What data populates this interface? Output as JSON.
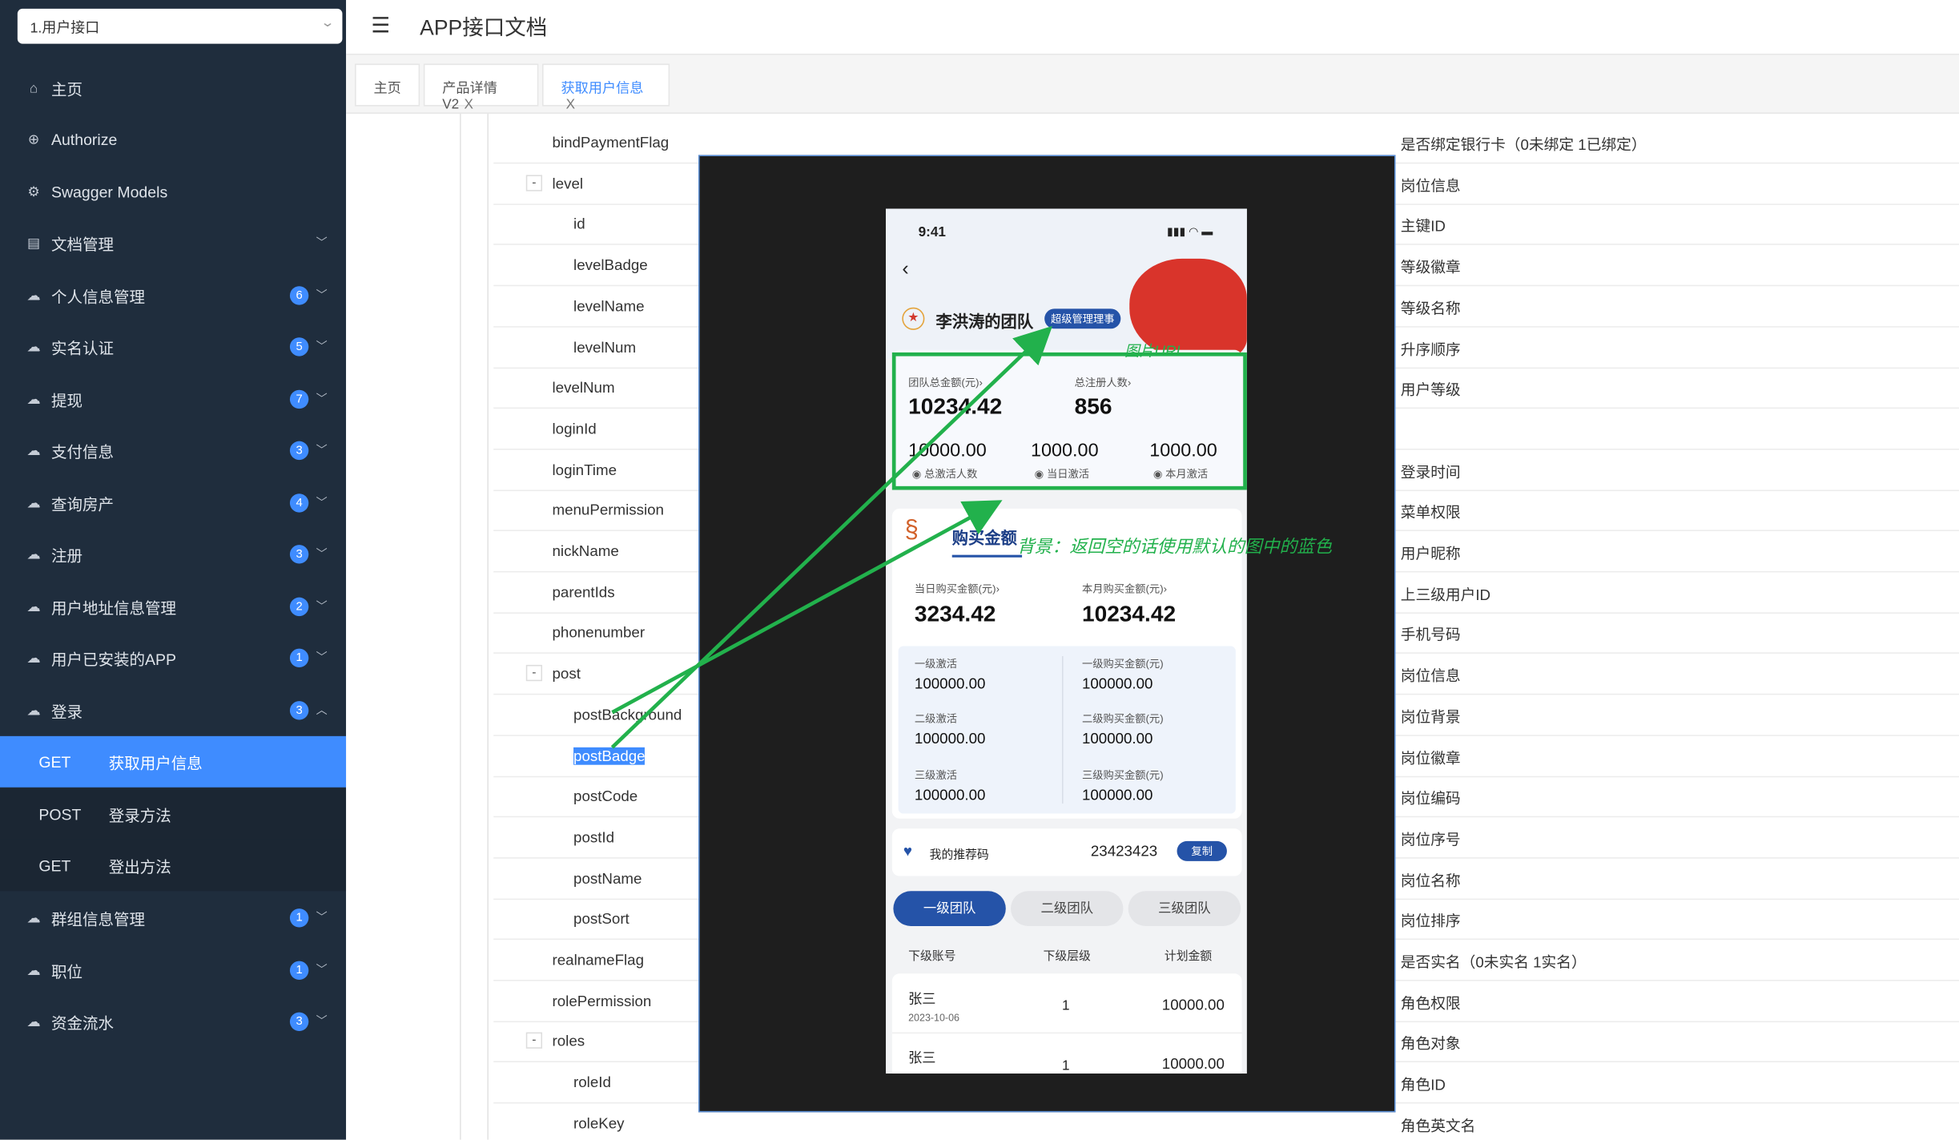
{
  "sidebar": {
    "select_value": "1.用户接口",
    "items": [
      {
        "label": "主页"
      },
      {
        "label": "Authorize"
      },
      {
        "label": "Swagger Models"
      },
      {
        "label": "文档管理"
      },
      {
        "label": "个人信息管理",
        "badge": "6"
      },
      {
        "label": "实名认证",
        "badge": "5"
      },
      {
        "label": "提现",
        "badge": "7"
      },
      {
        "label": "支付信息",
        "badge": "3"
      },
      {
        "label": "查询房产",
        "badge": "4"
      },
      {
        "label": "注册",
        "badge": "3"
      },
      {
        "label": "用户地址信息管理",
        "badge": "2"
      },
      {
        "label": "用户已安装的APP",
        "badge": "1"
      },
      {
        "label": "登录",
        "badge": "3"
      },
      {
        "label": "群组信息管理",
        "badge": "1"
      },
      {
        "label": "职位",
        "badge": "1"
      },
      {
        "label": "资金流水",
        "badge": "3"
      }
    ],
    "sub_items": [
      {
        "method": "GET",
        "label": "获取用户信息"
      },
      {
        "method": "POST",
        "label": "登录方法"
      },
      {
        "method": "GET",
        "label": "登出方法"
      }
    ]
  },
  "header": {
    "title": "APP接口文档"
  },
  "tabs": [
    {
      "label": "主页"
    },
    {
      "label": "产品详情V2",
      "close": "X"
    },
    {
      "label": "获取用户信息",
      "close": "X"
    }
  ],
  "rows": [
    {
      "name": "bindPaymentFlag",
      "desc": "是否绑定银行卡（0未绑定 1已绑定）"
    },
    {
      "name": "level",
      "desc": "岗位信息",
      "toggle": "-"
    },
    {
      "name": "id",
      "desc": "主键ID"
    },
    {
      "name": "levelBadge",
      "desc": "等级徽章"
    },
    {
      "name": "levelName",
      "desc": "等级名称"
    },
    {
      "name": "levelNum",
      "desc": "升序顺序"
    },
    {
      "name": "levelNum",
      "desc": "用户等级"
    },
    {
      "name": "loginId",
      "desc": ""
    },
    {
      "name": "loginTime",
      "desc": "登录时间"
    },
    {
      "name": "menuPermission",
      "desc": "菜单权限"
    },
    {
      "name": "nickName",
      "desc": "用户昵称"
    },
    {
      "name": "parentIds",
      "desc": "上三级用户ID"
    },
    {
      "name": "phonenumber",
      "desc": "手机号码"
    },
    {
      "name": "post",
      "desc": "岗位信息",
      "toggle": "-"
    },
    {
      "name": "postBackground",
      "desc": "岗位背景"
    },
    {
      "name": "postBadge",
      "desc": "岗位徽章"
    },
    {
      "name": "postCode",
      "desc": "岗位编码"
    },
    {
      "name": "postId",
      "desc": "岗位序号"
    },
    {
      "name": "postName",
      "desc": "岗位名称"
    },
    {
      "name": "postSort",
      "desc": "岗位排序"
    },
    {
      "name": "realnameFlag",
      "desc": "是否实名（0未实名 1实名）"
    },
    {
      "name": "rolePermission",
      "desc": "角色权限"
    },
    {
      "name": "roles",
      "desc": "角色对象",
      "toggle": "-"
    },
    {
      "name": "roleId",
      "desc": "角色ID"
    },
    {
      "name": "roleKey",
      "desc": "角色英文名"
    }
  ],
  "phone": {
    "time": "9:41",
    "team_name": "李洪涛的团队",
    "chip": "超级管理理事",
    "total_amount_label": "团队总金额(元)›",
    "total_amount": "10234.42",
    "total_reg_label": "总注册人数›",
    "total_reg": "856",
    "stats": [
      {
        "value": "10000.00",
        "label": "总激活人数"
      },
      {
        "value": "1000.00",
        "label": "当日激活"
      },
      {
        "value": "1000.00",
        "label": "本月激活"
      }
    ],
    "buy_title": "购买金额",
    "today_buy_label": "当日购买金额(元)›",
    "today_buy": "3234.42",
    "month_buy_label": "本月购买金额(元)›",
    "month_buy": "10234.42",
    "grid": [
      {
        "l1": "一级激活",
        "v1": "100000.00",
        "l2": "一级购买金额(元)",
        "v2": "100000.00"
      },
      {
        "l1": "二级激活",
        "v1": "100000.00",
        "l2": "二级购买金额(元)",
        "v2": "100000.00"
      },
      {
        "l1": "三级激活",
        "v1": "100000.00",
        "l2": "三级购买金额(元)",
        "v2": "100000.00"
      }
    ],
    "ref_label": "我的推荐码",
    "ref_code": "23423423",
    "copy": "复制",
    "team_tabs": [
      "一级团队",
      "二级团队",
      "三级团队"
    ],
    "table_headers": [
      "下级账号",
      "下级层级",
      "计划金额"
    ],
    "team_rows": [
      {
        "name": "张三",
        "date": "2023-10-06",
        "level": "1",
        "amount": "10000.00"
      },
      {
        "name": "张三",
        "date": "",
        "level": "1",
        "amount": "10000.00"
      }
    ]
  },
  "annotations": {
    "img_url": "图片URL",
    "bg_note": "背景：返回空的话使用默认的图中的蓝色"
  },
  "colors": {
    "sidebar": "#1f2d3d",
    "accent": "#3f8cff",
    "annotation": "#22b14c"
  }
}
